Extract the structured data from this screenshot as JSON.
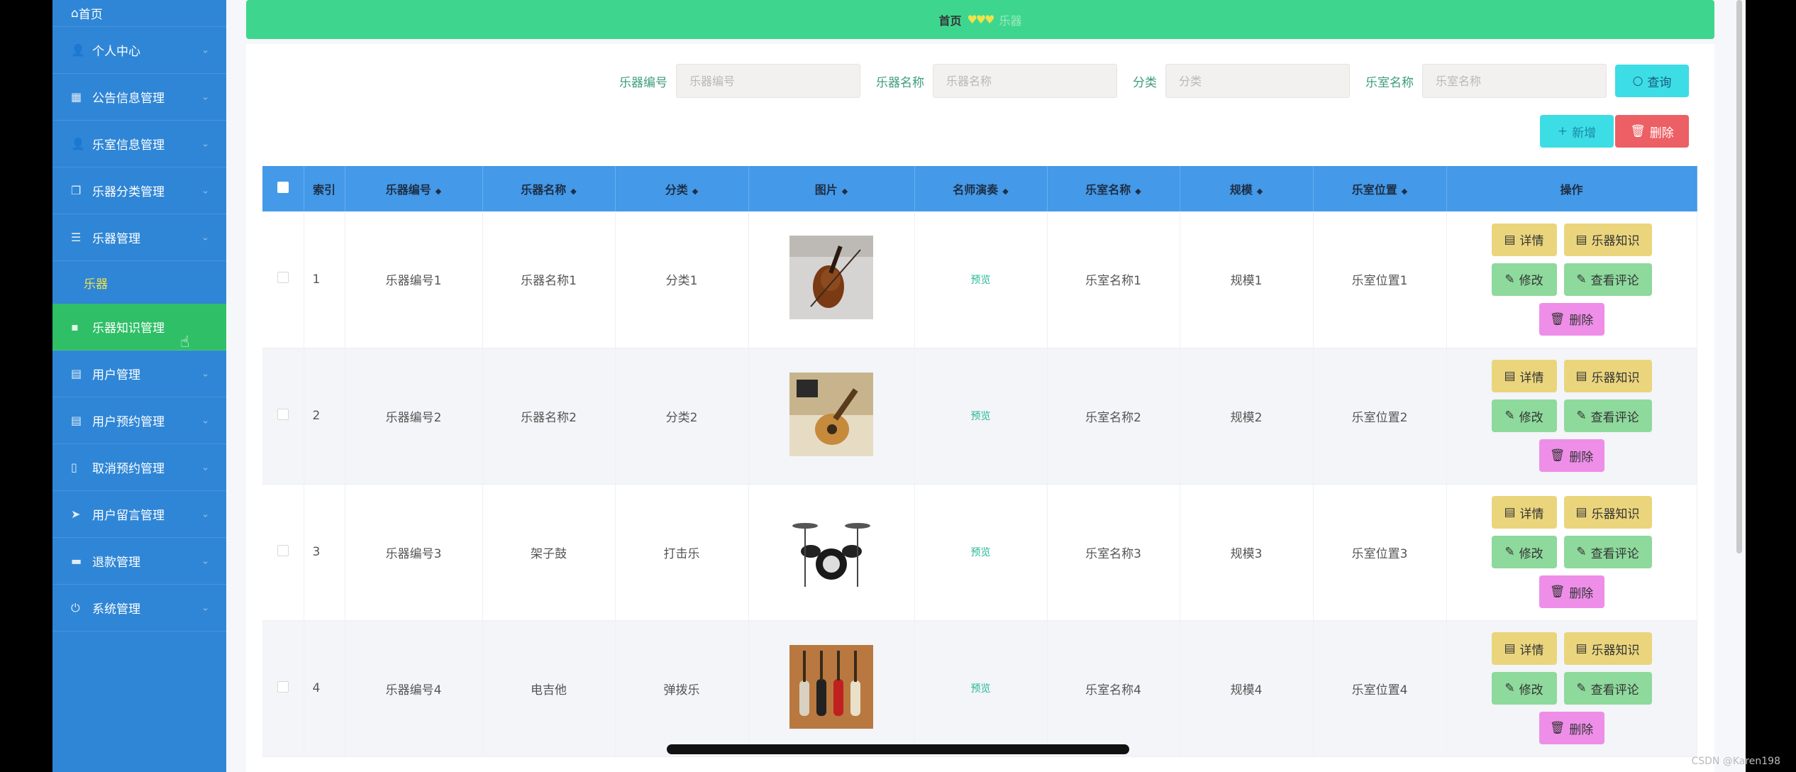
{
  "sidebar": {
    "home": "首页",
    "items": [
      {
        "label": "个人中心",
        "icon": "user-icon"
      },
      {
        "label": "公告信息管理",
        "icon": "grid-icon"
      },
      {
        "label": "乐室信息管理",
        "icon": "user-icon"
      },
      {
        "label": "乐器分类管理",
        "icon": "copy-icon"
      },
      {
        "label": "乐器管理",
        "icon": "list-icon"
      }
    ],
    "sub_item": "乐器",
    "active_item": "乐器知识管理",
    "items2": [
      {
        "label": "用户管理",
        "icon": "doc-icon"
      },
      {
        "label": "用户预约管理",
        "icon": "doc-icon"
      },
      {
        "label": "取消预约管理",
        "icon": "phone-icon"
      },
      {
        "label": "用户留言管理",
        "icon": "send-icon"
      },
      {
        "label": "退款管理",
        "icon": "card-icon"
      },
      {
        "label": "系统管理",
        "icon": "power-icon"
      }
    ]
  },
  "topbar": {
    "crumb1": "首页",
    "hearts": "♥♥♥",
    "crumb2": "乐器"
  },
  "search": {
    "f1_label": "乐器编号",
    "f1_placeholder": "乐器编号",
    "f2_label": "乐器名称",
    "f2_placeholder": "乐器名称",
    "f3_label": "分类",
    "f3_placeholder": "分类",
    "f4_label": "乐室名称",
    "f4_placeholder": "乐室名称",
    "query": "查询"
  },
  "actions": {
    "add": "新增",
    "delete": "删除"
  },
  "table": {
    "headers": [
      "索引",
      "乐器编号",
      "乐器名称",
      "分类",
      "图片",
      "名师演奏",
      "乐室名称",
      "规模",
      "乐室位置",
      "操作"
    ],
    "rows": [
      {
        "idx": "1",
        "code": "乐器编号1",
        "name": "乐器名称1",
        "cat": "分类1",
        "img": "violin",
        "play": "预览",
        "room": "乐室名称1",
        "scale": "规模1",
        "loc": "乐室位置1"
      },
      {
        "idx": "2",
        "code": "乐器编号2",
        "name": "乐器名称2",
        "cat": "分类2",
        "img": "guitar",
        "play": "预览",
        "room": "乐室名称2",
        "scale": "规模2",
        "loc": "乐室位置2"
      },
      {
        "idx": "3",
        "code": "乐器编号3",
        "name": "架子鼓",
        "cat": "打击乐",
        "img": "drums",
        "play": "预览",
        "room": "乐室名称3",
        "scale": "规模3",
        "loc": "乐室位置3"
      },
      {
        "idx": "4",
        "code": "乐器编号4",
        "name": "电吉他",
        "cat": "弹拨乐",
        "img": "electric-guitars",
        "play": "预览",
        "room": "乐室名称4",
        "scale": "规模4",
        "loc": "乐室位置4"
      }
    ],
    "ops": {
      "detail": "详情",
      "knowledge": "乐器知识",
      "edit": "修改",
      "comments": "查看评论",
      "remove": "删除"
    }
  },
  "watermark": "CSDN @Karen198"
}
